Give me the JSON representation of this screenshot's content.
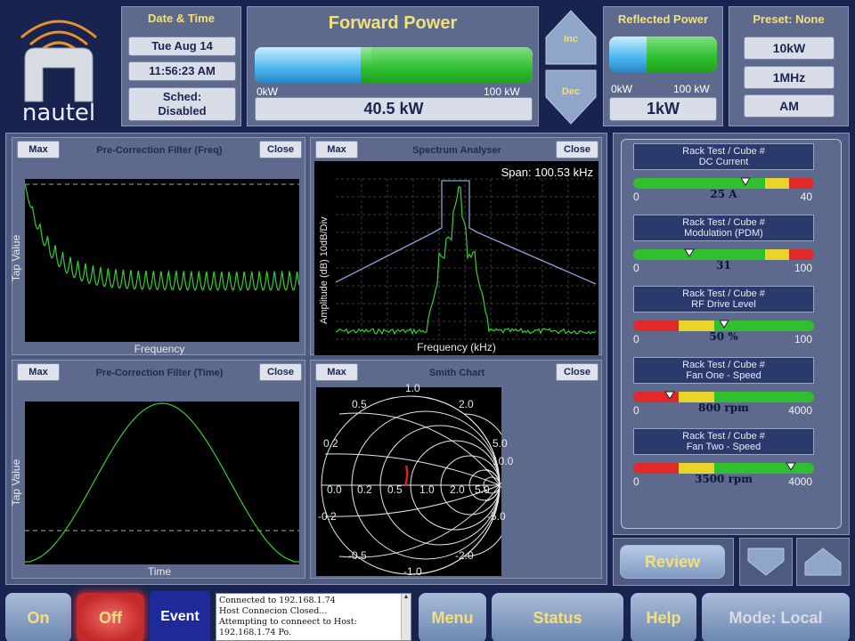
{
  "brand": {
    "logo_text": "nautel"
  },
  "datetime": {
    "label": "Date & Time",
    "date": "Tue Aug 14",
    "time": "11:56:23 AM",
    "sched": "Sched:\nDisabled"
  },
  "forward_power": {
    "title": "Forward Power",
    "scale_min": "0kW",
    "scale_max": "100 kW",
    "value": "40.5 kW",
    "fill_fraction": 0.405
  },
  "adjust": {
    "inc": "Inc",
    "dec": "Dec"
  },
  "reflected_power": {
    "title": "Reflected Power",
    "scale_min": "0kW",
    "scale_max": "100 kW",
    "value": "1kW"
  },
  "preset": {
    "title": "Preset: None",
    "options": [
      "10kW",
      "1MHz",
      "AM"
    ]
  },
  "charts": {
    "max_label": "Max",
    "close_label": "Close",
    "freq": {
      "title": "Pre-Correction Filter (Freq)",
      "xlabel": "Frequency",
      "ylabel": "Tap Value"
    },
    "spectrum": {
      "title": "Spectrum Analyser",
      "xlabel": "Frequency (kHz)",
      "ylabel": "Amplitude (dB) 10dB/Div",
      "span": "Span: 100.53 kHz"
    },
    "time": {
      "title": "Pre-Correction Filter (Time)",
      "xlabel": "Time",
      "ylabel": "Tap Value"
    },
    "smith": {
      "title": "Smith Chart",
      "labels": [
        "1.0",
        "0.5",
        "2.0",
        "0.2",
        "5.0",
        "10.0",
        "0.0",
        "0.2",
        "0.5",
        "1.0",
        "2.0",
        "5.0",
        "-0.2",
        "-5.0",
        "-0.5",
        "-2.0",
        "-1.0"
      ]
    }
  },
  "meters": [
    {
      "title": "Rack Test / Cube #\nDC Current",
      "value": "25 A",
      "min": "0",
      "max": "40",
      "fraction": 0.62
    },
    {
      "title": "Rack Test / Cube #\nModulation (PDM)",
      "value": "31",
      "min": "0",
      "max": "100",
      "fraction": 0.31
    },
    {
      "title": "Rack Test / Cube #\nRF Drive Level",
      "value": "50 %",
      "min": "0",
      "max": "100",
      "fraction": 0.5
    },
    {
      "title": "Rack Test / Cube #\nFan One - Speed",
      "value": "800 rpm",
      "min": "0",
      "max": "4000",
      "fraction": 0.2
    },
    {
      "title": "Rack Test / Cube #\nFan Two - Speed",
      "value": "3500 rpm",
      "min": "0",
      "max": "4000",
      "fraction": 0.87
    }
  ],
  "review": {
    "label": "Review"
  },
  "bottom": {
    "on": "On",
    "off": "Off",
    "event": "Event",
    "log": [
      "Connected to 192.168.1.74",
      "Host Connecion Closed...",
      "Attempting to conneect to Host:",
      "192.168.1.74 Po."
    ],
    "menu": "Menu",
    "status": "Status",
    "help": "Help",
    "mode": "Mode: Local"
  }
}
